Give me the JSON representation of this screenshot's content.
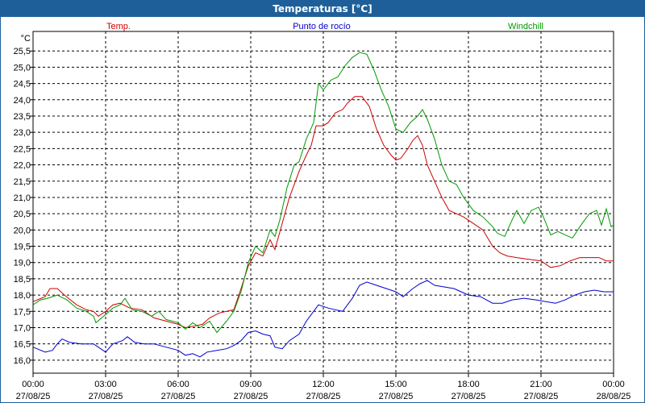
{
  "header": {
    "title": "Temperaturas [°C]"
  },
  "chart_data": {
    "type": "line",
    "title": "Temperaturas [°C]",
    "ylabel": "°C",
    "xlabel": "",
    "xlim": [
      0,
      24
    ],
    "ylim": [
      15.6,
      26.1
    ],
    "grid": true,
    "legend_placement": "top",
    "y_ticks": [
      "16,0",
      "16,5",
      "17,0",
      "17,5",
      "18,0",
      "18,5",
      "19,0",
      "19,5",
      "20,0",
      "20,5",
      "21,0",
      "21,5",
      "22,0",
      "22,5",
      "23,0",
      "23,5",
      "24,0",
      "24,5",
      "25,0",
      "25,5"
    ],
    "x_ticks": [
      {
        "time": "00:00",
        "date": "27/08/25"
      },
      {
        "time": "03:00",
        "date": "27/08/25"
      },
      {
        "time": "06:00",
        "date": "27/08/25"
      },
      {
        "time": "09:00",
        "date": "27/08/25"
      },
      {
        "time": "12:00",
        "date": "27/08/25"
      },
      {
        "time": "15:00",
        "date": "27/08/25"
      },
      {
        "time": "18:00",
        "date": "27/08/25"
      },
      {
        "time": "21:00",
        "date": "27/08/25"
      },
      {
        "time": "00:00",
        "date": "28/08/25"
      }
    ],
    "series": [
      {
        "name": "Temp.",
        "color": "#cc0000",
        "legend_position": "left",
        "points": [
          [
            0,
            17.8
          ],
          [
            0.5,
            17.95
          ],
          [
            0.7,
            18.2
          ],
          [
            1.0,
            18.2
          ],
          [
            1.3,
            18.0
          ],
          [
            1.8,
            17.7
          ],
          [
            2.2,
            17.55
          ],
          [
            2.5,
            17.5
          ],
          [
            2.7,
            17.35
          ],
          [
            3.0,
            17.5
          ],
          [
            3.3,
            17.7
          ],
          [
            3.6,
            17.75
          ],
          [
            4.0,
            17.6
          ],
          [
            4.5,
            17.55
          ],
          [
            5.0,
            17.3
          ],
          [
            5.5,
            17.2
          ],
          [
            6.0,
            17.1
          ],
          [
            6.3,
            17.0
          ],
          [
            6.7,
            17.05
          ],
          [
            7.0,
            17.1
          ],
          [
            7.3,
            17.3
          ],
          [
            7.7,
            17.45
          ],
          [
            8.0,
            17.5
          ],
          [
            8.3,
            17.55
          ],
          [
            8.6,
            18.2
          ],
          [
            8.9,
            18.9
          ],
          [
            9.2,
            19.3
          ],
          [
            9.5,
            19.2
          ],
          [
            9.8,
            19.7
          ],
          [
            10.0,
            19.4
          ],
          [
            10.3,
            20.2
          ],
          [
            10.6,
            21.0
          ],
          [
            11.0,
            21.8
          ],
          [
            11.3,
            22.3
          ],
          [
            11.5,
            22.6
          ],
          [
            11.7,
            23.2
          ],
          [
            12.0,
            23.2
          ],
          [
            12.2,
            23.3
          ],
          [
            12.5,
            23.6
          ],
          [
            12.8,
            23.7
          ],
          [
            13.0,
            23.9
          ],
          [
            13.3,
            24.1
          ],
          [
            13.6,
            24.1
          ],
          [
            13.9,
            23.8
          ],
          [
            14.2,
            23.1
          ],
          [
            14.5,
            22.6
          ],
          [
            14.8,
            22.3
          ],
          [
            15.0,
            22.15
          ],
          [
            15.2,
            22.2
          ],
          [
            15.5,
            22.5
          ],
          [
            15.7,
            22.75
          ],
          [
            15.9,
            22.9
          ],
          [
            16.1,
            22.6
          ],
          [
            16.3,
            22.0
          ],
          [
            16.6,
            21.5
          ],
          [
            16.9,
            21.0
          ],
          [
            17.2,
            20.6
          ],
          [
            17.5,
            20.5
          ],
          [
            17.8,
            20.4
          ],
          [
            18.2,
            20.2
          ],
          [
            18.6,
            20.0
          ],
          [
            19.0,
            19.5
          ],
          [
            19.3,
            19.3
          ],
          [
            19.6,
            19.2
          ],
          [
            20.0,
            19.15
          ],
          [
            20.5,
            19.1
          ],
          [
            21.0,
            19.05
          ],
          [
            21.4,
            18.85
          ],
          [
            21.8,
            18.9
          ],
          [
            22.2,
            19.05
          ],
          [
            22.6,
            19.15
          ],
          [
            23.0,
            19.15
          ],
          [
            23.4,
            19.15
          ],
          [
            23.7,
            19.05
          ],
          [
            24.0,
            19.05
          ]
        ]
      },
      {
        "name": "Punto de rocío",
        "color": "#0000cc",
        "legend_position": "center",
        "points": [
          [
            0,
            16.4
          ],
          [
            0.5,
            16.25
          ],
          [
            0.8,
            16.3
          ],
          [
            1.0,
            16.5
          ],
          [
            1.2,
            16.65
          ],
          [
            1.5,
            16.55
          ],
          [
            2.0,
            16.5
          ],
          [
            2.5,
            16.5
          ],
          [
            3.0,
            16.25
          ],
          [
            3.3,
            16.5
          ],
          [
            3.7,
            16.6
          ],
          [
            3.9,
            16.72
          ],
          [
            4.2,
            16.55
          ],
          [
            4.6,
            16.5
          ],
          [
            5.0,
            16.5
          ],
          [
            5.5,
            16.4
          ],
          [
            6.0,
            16.3
          ],
          [
            6.3,
            16.15
          ],
          [
            6.6,
            16.2
          ],
          [
            6.9,
            16.1
          ],
          [
            7.2,
            16.25
          ],
          [
            7.6,
            16.3
          ],
          [
            8.0,
            16.35
          ],
          [
            8.3,
            16.45
          ],
          [
            8.6,
            16.6
          ],
          [
            8.9,
            16.85
          ],
          [
            9.2,
            16.9
          ],
          [
            9.5,
            16.8
          ],
          [
            9.8,
            16.75
          ],
          [
            10.0,
            16.4
          ],
          [
            10.3,
            16.35
          ],
          [
            10.6,
            16.6
          ],
          [
            11.0,
            16.8
          ],
          [
            11.3,
            17.2
          ],
          [
            11.6,
            17.5
          ],
          [
            11.8,
            17.7
          ],
          [
            12.2,
            17.6
          ],
          [
            12.5,
            17.55
          ],
          [
            12.8,
            17.5
          ],
          [
            13.0,
            17.7
          ],
          [
            13.2,
            17.9
          ],
          [
            13.5,
            18.3
          ],
          [
            13.8,
            18.4
          ],
          [
            14.2,
            18.3
          ],
          [
            14.6,
            18.2
          ],
          [
            15.0,
            18.1
          ],
          [
            15.3,
            17.95
          ],
          [
            15.7,
            18.2
          ],
          [
            16.0,
            18.35
          ],
          [
            16.3,
            18.45
          ],
          [
            16.6,
            18.3
          ],
          [
            17.0,
            18.25
          ],
          [
            17.4,
            18.2
          ],
          [
            17.7,
            18.1
          ],
          [
            18.0,
            18.0
          ],
          [
            18.5,
            17.95
          ],
          [
            19.0,
            17.75
          ],
          [
            19.4,
            17.75
          ],
          [
            19.8,
            17.85
          ],
          [
            20.3,
            17.9
          ],
          [
            20.8,
            17.85
          ],
          [
            21.2,
            17.8
          ],
          [
            21.6,
            17.75
          ],
          [
            22.0,
            17.85
          ],
          [
            22.4,
            18.0
          ],
          [
            22.8,
            18.1
          ],
          [
            23.2,
            18.15
          ],
          [
            23.6,
            18.1
          ],
          [
            24.0,
            18.1
          ]
        ]
      },
      {
        "name": "Windchill",
        "color": "#009900",
        "legend_position": "right",
        "points": [
          [
            0,
            17.7
          ],
          [
            0.3,
            17.85
          ],
          [
            0.6,
            17.9
          ],
          [
            1.0,
            18.0
          ],
          [
            1.4,
            17.85
          ],
          [
            1.8,
            17.6
          ],
          [
            2.2,
            17.5
          ],
          [
            2.5,
            17.35
          ],
          [
            2.6,
            17.15
          ],
          [
            3.0,
            17.4
          ],
          [
            3.3,
            17.6
          ],
          [
            3.6,
            17.7
          ],
          [
            3.8,
            17.9
          ],
          [
            4.1,
            17.55
          ],
          [
            4.5,
            17.5
          ],
          [
            4.9,
            17.35
          ],
          [
            5.2,
            17.5
          ],
          [
            5.5,
            17.25
          ],
          [
            6.0,
            17.15
          ],
          [
            6.3,
            16.95
          ],
          [
            6.6,
            17.15
          ],
          [
            6.9,
            17.0
          ],
          [
            7.3,
            17.2
          ],
          [
            7.6,
            16.85
          ],
          [
            8.0,
            17.2
          ],
          [
            8.3,
            17.5
          ],
          [
            8.6,
            18.1
          ],
          [
            8.9,
            19.0
          ],
          [
            9.2,
            19.5
          ],
          [
            9.5,
            19.3
          ],
          [
            9.8,
            20.0
          ],
          [
            10.0,
            19.8
          ],
          [
            10.2,
            20.3
          ],
          [
            10.5,
            21.3
          ],
          [
            10.8,
            22.0
          ],
          [
            11.0,
            22.1
          ],
          [
            11.3,
            22.8
          ],
          [
            11.6,
            23.3
          ],
          [
            11.8,
            24.5
          ],
          [
            12.0,
            24.3
          ],
          [
            12.3,
            24.6
          ],
          [
            12.6,
            24.7
          ],
          [
            12.9,
            25.05
          ],
          [
            13.2,
            25.3
          ],
          [
            13.5,
            25.45
          ],
          [
            13.8,
            25.4
          ],
          [
            14.1,
            24.9
          ],
          [
            14.4,
            24.3
          ],
          [
            14.7,
            23.8
          ],
          [
            15.0,
            23.1
          ],
          [
            15.3,
            23.0
          ],
          [
            15.6,
            23.3
          ],
          [
            15.9,
            23.5
          ],
          [
            16.1,
            23.7
          ],
          [
            16.3,
            23.4
          ],
          [
            16.6,
            22.8
          ],
          [
            16.9,
            22.0
          ],
          [
            17.2,
            21.5
          ],
          [
            17.5,
            21.4
          ],
          [
            17.8,
            21.0
          ],
          [
            18.2,
            20.6
          ],
          [
            18.6,
            20.4
          ],
          [
            19.0,
            20.1
          ],
          [
            19.2,
            19.9
          ],
          [
            19.5,
            19.8
          ],
          [
            19.8,
            20.3
          ],
          [
            20.0,
            20.6
          ],
          [
            20.3,
            20.2
          ],
          [
            20.6,
            20.6
          ],
          [
            20.9,
            20.7
          ],
          [
            21.1,
            20.4
          ],
          [
            21.4,
            19.85
          ],
          [
            21.7,
            19.95
          ],
          [
            22.0,
            19.85
          ],
          [
            22.3,
            19.75
          ],
          [
            22.7,
            20.2
          ],
          [
            23.0,
            20.5
          ],
          [
            23.3,
            20.6
          ],
          [
            23.5,
            20.15
          ],
          [
            23.7,
            20.65
          ],
          [
            23.9,
            20.1
          ],
          [
            24.0,
            20.15
          ]
        ]
      }
    ]
  }
}
